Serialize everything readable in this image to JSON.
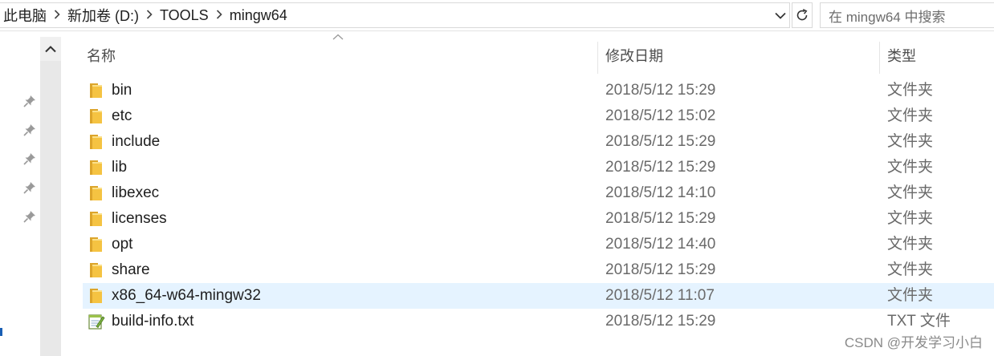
{
  "breadcrumb": [
    "此电脑",
    "新加卷 (D:)",
    "TOOLS",
    "mingw64"
  ],
  "search_placeholder": "在 mingw64 中搜索",
  "columns": {
    "name": "名称",
    "date": "修改日期",
    "type": "类型"
  },
  "files": [
    {
      "name": "bin",
      "date": "2018/5/12 15:29",
      "type": "文件夹",
      "icon": "folder-icon",
      "selected": false
    },
    {
      "name": "etc",
      "date": "2018/5/12 15:02",
      "type": "文件夹",
      "icon": "folder-icon",
      "selected": false
    },
    {
      "name": "include",
      "date": "2018/5/12 15:29",
      "type": "文件夹",
      "icon": "folder-icon",
      "selected": false
    },
    {
      "name": "lib",
      "date": "2018/5/12 15:29",
      "type": "文件夹",
      "icon": "folder-icon",
      "selected": false
    },
    {
      "name": "libexec",
      "date": "2018/5/12 14:10",
      "type": "文件夹",
      "icon": "folder-icon",
      "selected": false
    },
    {
      "name": "licenses",
      "date": "2018/5/12 15:29",
      "type": "文件夹",
      "icon": "folder-icon",
      "selected": false
    },
    {
      "name": "opt",
      "date": "2018/5/12 14:40",
      "type": "文件夹",
      "icon": "folder-icon",
      "selected": false
    },
    {
      "name": "share",
      "date": "2018/5/12 15:29",
      "type": "文件夹",
      "icon": "folder-icon",
      "selected": false
    },
    {
      "name": "x86_64-w64-mingw32",
      "date": "2018/5/12 11:07",
      "type": "文件夹",
      "icon": "folder-icon",
      "selected": true
    },
    {
      "name": "build-info.txt",
      "date": "2018/5/12 15:29",
      "type": "TXT 文件",
      "icon": "text-file-icon",
      "selected": false
    }
  ],
  "watermark": "CSDN @开发学习小白",
  "colors": {
    "selection": "#e5f3ff",
    "folder": "#f5c342",
    "folder_dark": "#dca52b"
  }
}
